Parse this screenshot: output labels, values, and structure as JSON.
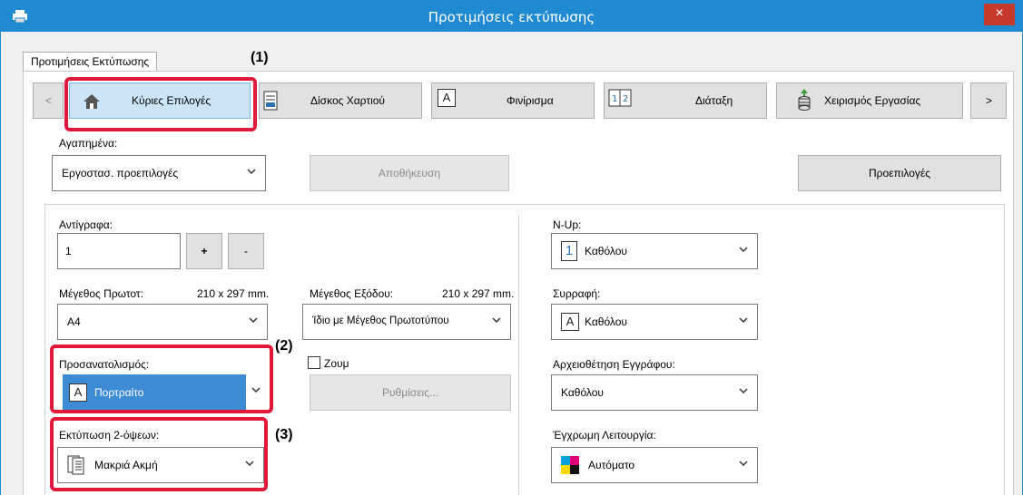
{
  "window": {
    "title": "Προτιμήσεις εκτύπωσης",
    "close_label": "×"
  },
  "tab": {
    "label": "Προτιμήσεις Εκτύπωσης"
  },
  "nav": {
    "prev_label": "<",
    "next_label": ">",
    "items": [
      {
        "label": "Κύριες Επιλογές",
        "icon": "home-icon"
      },
      {
        "label": "Δίσκος Χαρτιού",
        "icon": "paper-tray-icon"
      },
      {
        "label": "Φινίρισμα",
        "icon": "finishing-icon"
      },
      {
        "label": "Διάταξη",
        "icon": "layout-icon"
      },
      {
        "label": "Χειρισμός Εργασίας",
        "icon": "job-handling-icon"
      }
    ]
  },
  "favorites": {
    "label": "Αγαπημένα:",
    "value": "Εργοστασ. προεπιλογές",
    "save_label": "Αποθήκευση",
    "defaults_label": "Προεπιλογές"
  },
  "copies": {
    "label": "Αντίγραφα:",
    "value": "1",
    "plus": "+",
    "minus": "-"
  },
  "original_size": {
    "label": "Μέγεθος Πρωτοτ:",
    "dims": "210 x 297 mm.",
    "value": "A4"
  },
  "output_size": {
    "label": "Μέγεθος Εξόδου:",
    "dims": "210 x 297 mm.",
    "value": "Ίδιο με Μέγεθος Πρωτοτύπου"
  },
  "orientation": {
    "label": "Προσανατολισμός:",
    "value": "Πορτραίτο",
    "icon_glyph": "A"
  },
  "zoom": {
    "label": "Ζουμ",
    "settings_label": "Ρυθμίσεις..."
  },
  "duplex": {
    "label": "Εκτύπωση 2-όψεων:",
    "value": "Μακριά Ακμή"
  },
  "nup": {
    "label": "N-Up:",
    "value": "Καθόλου",
    "icon_glyph": "1"
  },
  "collate": {
    "label": "Συρραφή:",
    "value": "Καθόλου",
    "icon_glyph": "A"
  },
  "retention": {
    "label": "Αρχειοθέτηση Εγγράφου:",
    "value": "Καθόλου"
  },
  "color_mode": {
    "label": "Έγχρωμη Λειτουργία:",
    "value": "Αυτόματο"
  },
  "callouts": {
    "c1": "(1)",
    "c2": "(2)",
    "c3": "(3)"
  },
  "colors": {
    "titlebar": "#1f8ad2",
    "highlight": "#3d8bd4",
    "callout_red": "#e0183a"
  }
}
